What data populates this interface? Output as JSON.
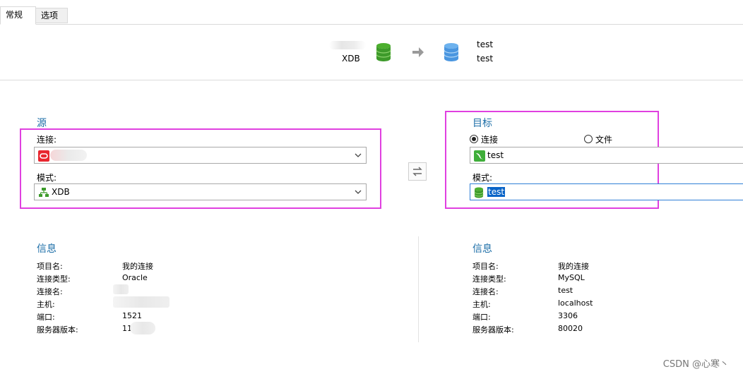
{
  "tabs": [
    {
      "label": "常规",
      "active": true
    },
    {
      "label": "选项",
      "active": false
    }
  ],
  "transfer": {
    "source_schema": "XDB",
    "target_connection": "test",
    "target_schema": "test"
  },
  "source": {
    "title": "源",
    "connection_label": "连接:",
    "connection_value": "",
    "schema_label": "模式:",
    "schema_value": "XDB"
  },
  "target": {
    "title": "目标",
    "radio_connection": "连接",
    "radio_file": "文件",
    "selected_radio": "连接",
    "connection_value": "test",
    "schema_label": "模式:",
    "schema_value": "test"
  },
  "source_info": {
    "title": "信息",
    "rows": [
      {
        "key": "项目名:",
        "value": "我的连接"
      },
      {
        "key": "连接类型:",
        "value": "Oracle"
      },
      {
        "key": "连接名:",
        "value": ""
      },
      {
        "key": "主机:",
        "value": ""
      },
      {
        "key": "端口:",
        "value": "1521"
      },
      {
        "key": "服务器版本:",
        "value": "11"
      }
    ]
  },
  "target_info": {
    "title": "信息",
    "rows": [
      {
        "key": "项目名:",
        "value": "我的连接"
      },
      {
        "key": "连接类型:",
        "value": "MySQL"
      },
      {
        "key": "连接名:",
        "value": "test"
      },
      {
        "key": "主机:",
        "value": "localhost"
      },
      {
        "key": "端口:",
        "value": "3306"
      },
      {
        "key": "服务器版本:",
        "value": "80020"
      }
    ]
  },
  "watermark": "CSDN @心寒丶",
  "colors": {
    "section_title": "#1e6fa8",
    "highlight_border": "#e040e0",
    "db_green": "#3d9a2a",
    "db_blue": "#4a96e0",
    "oracle_red": "#e8262f",
    "selection": "#0a64c8"
  }
}
